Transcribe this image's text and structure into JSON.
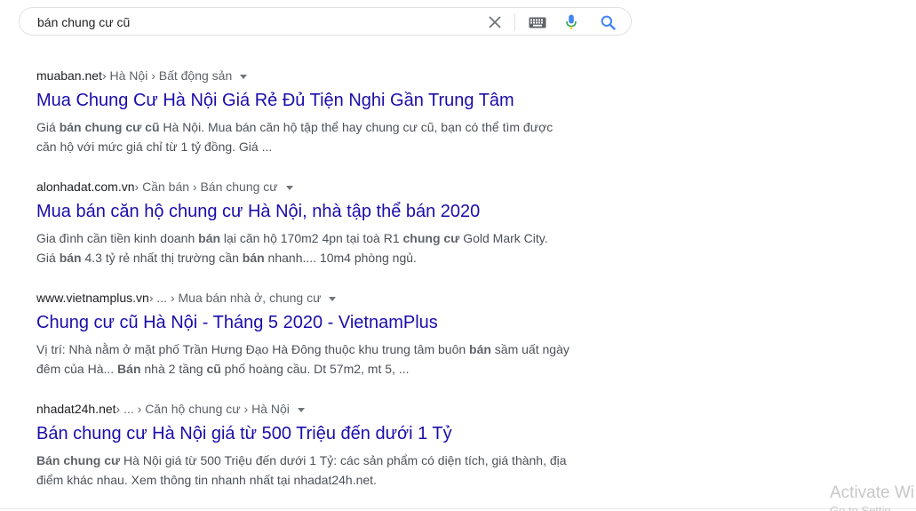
{
  "search": {
    "query": "bán chung cư cũ"
  },
  "icons": {
    "clear": "close-icon",
    "keyboard": "keyboard-icon",
    "voice": "microphone-icon",
    "search": "magnifier-icon"
  },
  "colors": {
    "title_link": "#1a0dab",
    "snippet_text": "#4d5156",
    "mic_blue": "#4285f4",
    "mic_red": "#ea4335",
    "search_blue": "#4285f4"
  },
  "results": [
    {
      "domain": "muaban.net",
      "crumbs": " › Hà Nội › Bất động sản",
      "title": "Mua Chung Cư Hà Nội Giá Rẻ Đủ Tiện Nghi Gần Trung Tâm",
      "snippet_lines": [
        [
          {
            "t": "Giá ",
            "b": false
          },
          {
            "t": "bán chung cư cũ",
            "b": true
          },
          {
            "t": " Hà Nội. Mua bán căn hộ tập thể hay chung cư cũ, bạn có thể tìm được",
            "b": false
          }
        ],
        [
          {
            "t": "căn hộ với mức giá chỉ từ 1 tỷ đồng. Giá ...",
            "b": false
          }
        ]
      ]
    },
    {
      "domain": "alonhadat.com.vn",
      "crumbs": " › Cần bán › Bán chung cư",
      "title": "Mua bán căn hộ chung cư Hà Nội, nhà tập thể bán 2020",
      "snippet_lines": [
        [
          {
            "t": "Gia đình cần tiền kinh doanh ",
            "b": false
          },
          {
            "t": "bán",
            "b": true
          },
          {
            "t": " lại căn hộ 170m2 4pn tại toà R1 ",
            "b": false
          },
          {
            "t": "chung cư",
            "b": true
          },
          {
            "t": " Gold Mark City.",
            "b": false
          }
        ],
        [
          {
            "t": "Giá ",
            "b": false
          },
          {
            "t": "bán",
            "b": true
          },
          {
            "t": " 4.3 tỷ rẻ nhất thị trường cần ",
            "b": false
          },
          {
            "t": "bán",
            "b": true
          },
          {
            "t": " nhanh.... 10m4 phòng ngủ.",
            "b": false
          }
        ]
      ]
    },
    {
      "domain": "www.vietnamplus.vn",
      "crumbs": " › ... › Mua bán nhà ở, chung cư",
      "title": "Chung cư cũ Hà Nội - Tháng 5 2020 - VietnamPlus",
      "snippet_lines": [
        [
          {
            "t": "Vị trí: Nhà nằm ở mặt phố Trần Hưng Đạo Hà Đông thuộc khu trung tâm buôn ",
            "b": false
          },
          {
            "t": "bán",
            "b": true
          },
          {
            "t": " sầm uất ngày",
            "b": false
          }
        ],
        [
          {
            "t": "đêm của Hà... ",
            "b": false
          },
          {
            "t": "Bán",
            "b": true
          },
          {
            "t": " nhà 2 tầng ",
            "b": false
          },
          {
            "t": "cũ",
            "b": true
          },
          {
            "t": " phố hoàng cầu. Dt 57m2, mt 5, ...",
            "b": false
          }
        ]
      ]
    },
    {
      "domain": "nhadat24h.net",
      "crumbs": " › ... › Căn hộ chung cư › Hà Nội",
      "title": "Bán chung cư Hà Nội giá từ 500 Triệu đến dưới 1 Tỷ",
      "snippet_lines": [
        [
          {
            "t": "Bán chung cư",
            "b": true
          },
          {
            "t": " Hà Nội giá từ 500 Triệu đến dưới 1 Tỷ: các sản phẩm có diện tích, giá thành, địa",
            "b": false
          }
        ],
        [
          {
            "t": "điểm khác nhau. Xem thông tin nhanh nhất tại nhadat24h.net.",
            "b": false
          }
        ]
      ]
    }
  ],
  "watermark": {
    "title": "Activate Wi",
    "subtitle": "Go to Settin"
  }
}
